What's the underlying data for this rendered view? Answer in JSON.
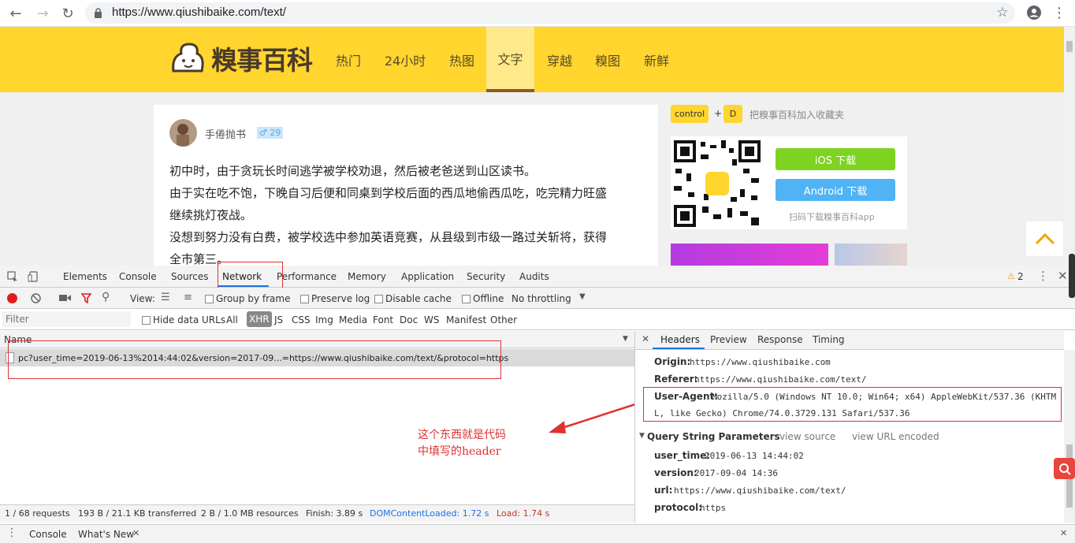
{
  "browser": {
    "url": "https://www.qiushibaike.com/text/"
  },
  "site": {
    "logo_text": "糗事百科",
    "nav": [
      "热门",
      "24小时",
      "热图",
      "文字",
      "穿越",
      "糗图",
      "新鲜"
    ],
    "active_nav": "文字"
  },
  "post": {
    "author": "手倦抛书",
    "badge": "♂ 29",
    "paragraphs": [
      "初中时，由于贪玩长时间逃学被学校劝退，然后被老爸送到山区读书。",
      "由于实在吃不饱，下晚自习后便和同桌到学校后面的西瓜地偷西瓜吃，吃完精力旺盛",
      "继续挑灯夜战。",
      "没想到努力没有白费，被学校选中参加英语竞赛，从县级到市级一路过关斩将，获得",
      "全市第三。"
    ]
  },
  "sidebar": {
    "key1": "control",
    "plus": "+",
    "key2": "D",
    "bookmark_text": "把糗事百科加入收藏夹",
    "ios_button": "iOS 下载",
    "android_button": "Android 下载",
    "scan_text": "扫码下载糗事百科app"
  },
  "devtools": {
    "tabs": [
      "Elements",
      "Console",
      "Sources",
      "Network",
      "Performance",
      "Memory",
      "Application",
      "Security",
      "Audits"
    ],
    "active_tab": "Network",
    "warning_count": "2",
    "toolbar": {
      "view_label": "View:",
      "group_by_frame": "Group by frame",
      "preserve_log": "Preserve log",
      "disable_cache": "Disable cache",
      "offline": "Offline",
      "throttling": "No throttling"
    },
    "filter_placeholder": "Filter",
    "filter_bar": {
      "hide_data_urls": "Hide data URLs",
      "types": [
        "All",
        "XHR",
        "JS",
        "CSS",
        "Img",
        "Media",
        "Font",
        "Doc",
        "WS",
        "Manifest",
        "Other"
      ],
      "active_type": "XHR"
    },
    "name_header": "Name",
    "request_name": "pc?user_time=2019-06-13%2014:44:02&version=2017-09...=https://www.qiushibaike.com/text/&protocol=https",
    "annotation_line1": "这个东西就是代码",
    "annotation_line2": "中填写的header",
    "status": {
      "requests": "1 / 68 requests",
      "transferred": "193 B / 21.1 KB transferred",
      "resources": "2 B / 1.0 MB resources",
      "finish": "Finish: 3.89 s",
      "dcl": "DOMContentLoaded: 1.72 s",
      "load": "Load: 1.74 s"
    },
    "detail_tabs": [
      "Headers",
      "Preview",
      "Response",
      "Timing"
    ],
    "active_detail_tab": "Headers",
    "headers": {
      "origin_key": "Origin:",
      "origin_val": "https://www.qiushibaike.com",
      "referer_key": "Referer:",
      "referer_val": "https://www.qiushibaike.com/text/",
      "ua_key": "User-Agent:",
      "ua_val1": "Mozilla/5.0 (Windows NT 10.0; Win64; x64) AppleWebKit/537.36 (KHTM",
      "ua_val2": "L, like Gecko) Chrome/74.0.3729.131 Safari/537.36"
    },
    "query": {
      "title": "Query String Parameters",
      "view_source": "view source",
      "view_url_encoded": "view URL encoded",
      "params": [
        {
          "k": "user_time:",
          "v": "2019-06-13 14:44:02"
        },
        {
          "k": "version:",
          "v": "2017-09-04 14:36"
        },
        {
          "k": "url:",
          "v": "https://www.qiushibaike.com/text/"
        },
        {
          "k": "protocol:",
          "v": "https"
        }
      ]
    },
    "drawer": {
      "console": "Console",
      "whats_new": "What's New"
    }
  },
  "colors": {
    "site_yellow": "#ffd52e",
    "ios_green": "#7ed321",
    "android_blue": "#4fb3f6",
    "annotation_red": "#e03131",
    "devtools_blue": "#1a73e8"
  }
}
